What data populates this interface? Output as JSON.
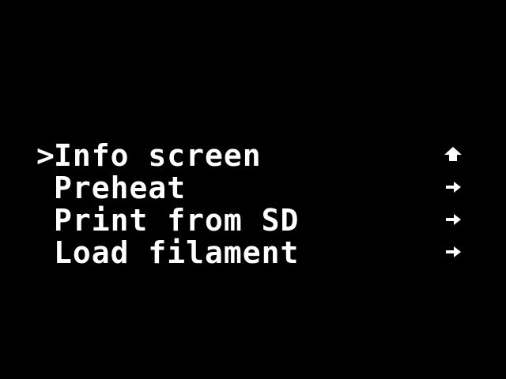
{
  "colors": {
    "background": "#000000",
    "foreground": "#ffffff"
  },
  "menu": {
    "cursor": ">",
    "selected_index": 0,
    "items": [
      {
        "label": "Info screen",
        "icon": "up-arrow-icon"
      },
      {
        "label": "Preheat",
        "icon": "right-arrow-icon"
      },
      {
        "label": "Print from SD",
        "icon": "right-arrow-icon"
      },
      {
        "label": "Load filament",
        "icon": "right-arrow-icon"
      }
    ]
  }
}
